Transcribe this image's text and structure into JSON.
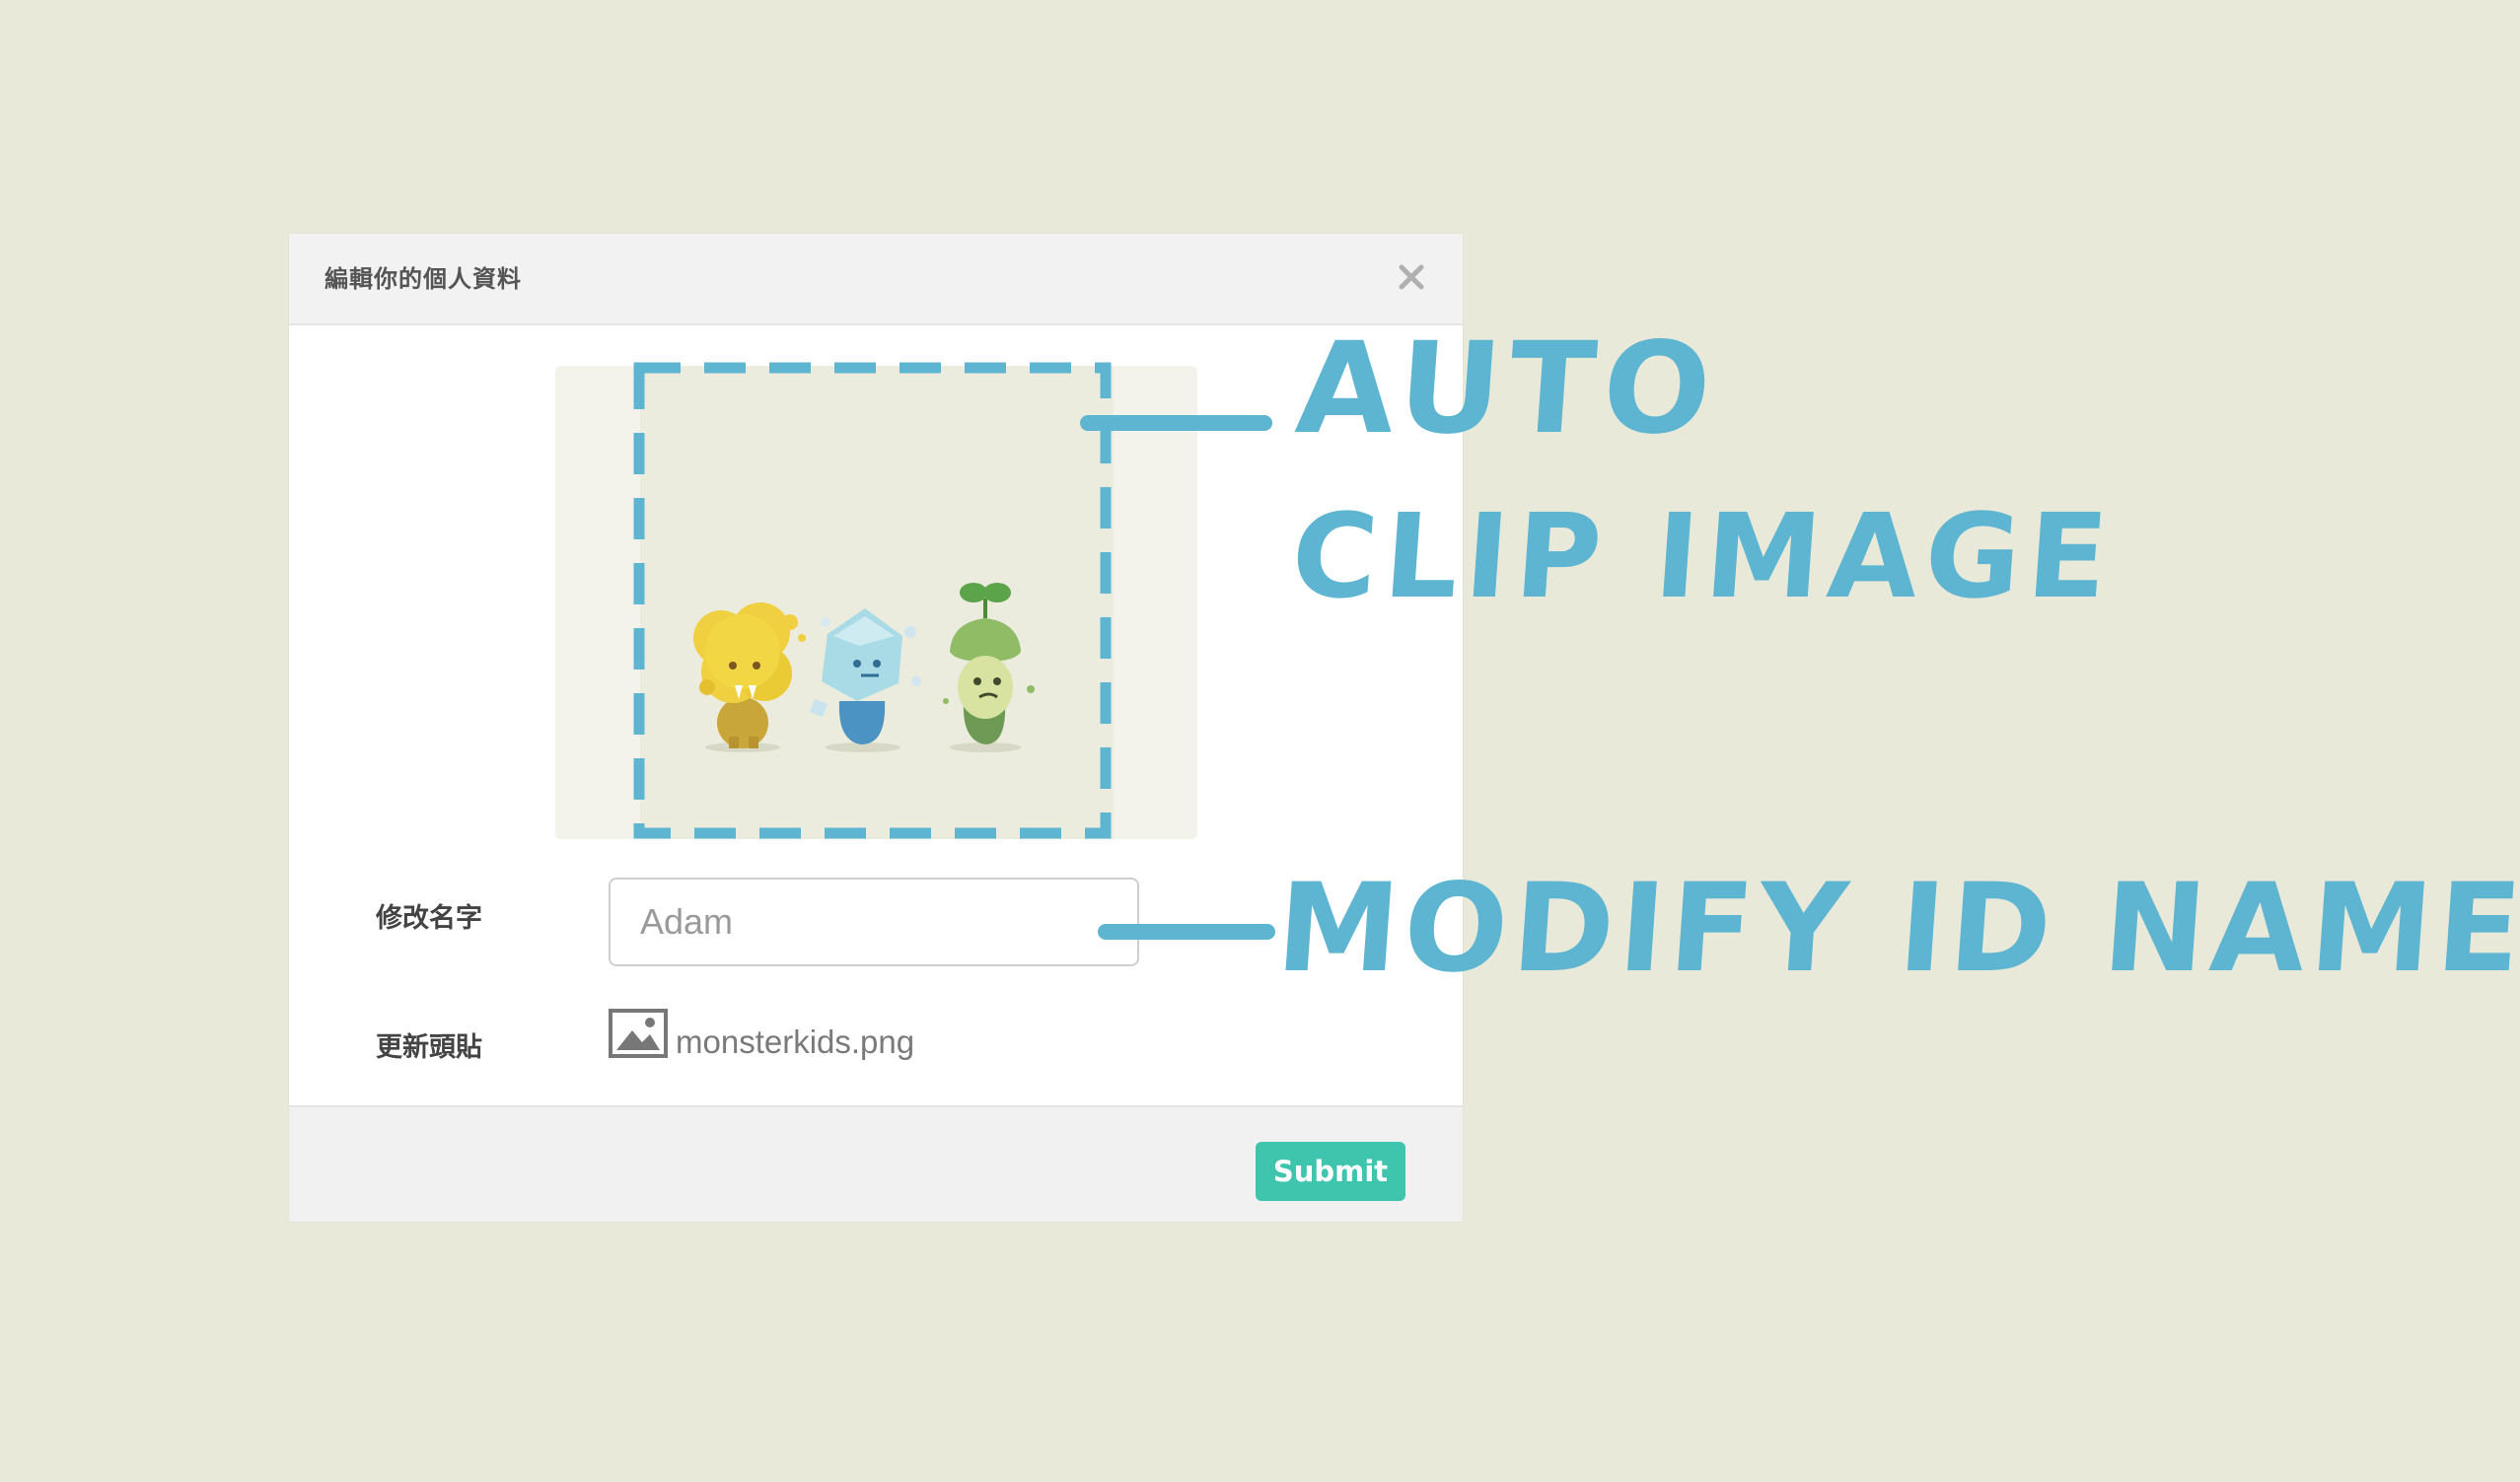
{
  "dialog": {
    "title": "編輯你的個人資料",
    "close_label": "×"
  },
  "form": {
    "name_label": "修改名字",
    "name_placeholder": "Adam",
    "avatar_label": "更新頭貼",
    "avatar_file": "monsterkids.png"
  },
  "footer": {
    "submit_label": "Submit"
  },
  "annotations": {
    "auto": "AUTO",
    "clip_image": "CLIP IMAGE",
    "modify_id": "MODIFY ID NAME"
  },
  "colors": {
    "background": "#e9e9da",
    "accent": "#3fc4ad",
    "annotation": "#5db5d1"
  }
}
